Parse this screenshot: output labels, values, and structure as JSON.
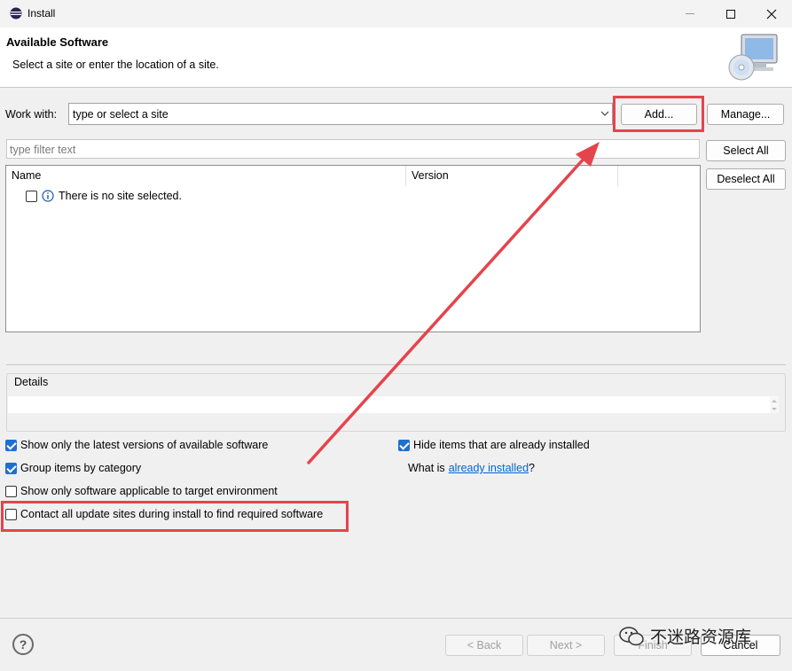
{
  "window": {
    "title": "Install"
  },
  "header": {
    "title": "Available Software",
    "description": "Select a site or enter the location of a site."
  },
  "work_with": {
    "label": "Work with:",
    "value": "type or select a site",
    "add_label": "Add...",
    "manage_label": "Manage..."
  },
  "filter": {
    "placeholder": "type filter text"
  },
  "buttons": {
    "select_all": "Select All",
    "deselect_all": "Deselect All"
  },
  "table": {
    "columns": [
      "Name",
      "Version"
    ],
    "rows": [
      {
        "text": "There is no site selected.",
        "checked": false
      }
    ]
  },
  "details": {
    "label": "Details"
  },
  "options": {
    "latest": {
      "label": "Show only the latest versions of available software",
      "checked": true
    },
    "group": {
      "label": "Group items by category",
      "checked": true
    },
    "target": {
      "label": "Show only software applicable to target environment",
      "checked": false
    },
    "contact": {
      "label": "Contact all update sites during install to find required software",
      "checked": false
    },
    "hide": {
      "label": "Hide items that are already installed",
      "checked": true
    },
    "what_is_prefix": "What is",
    "what_is_link": "already installed",
    "what_is_suffix": "?"
  },
  "footer": {
    "help": "?",
    "back": "< Back",
    "next": "Next >",
    "finish": "Finish",
    "cancel": "Cancel",
    "watermark": "不迷路资源库"
  },
  "colors": {
    "highlight": "#e5444d",
    "check": "#1e6fd0",
    "link": "#0066cc"
  }
}
